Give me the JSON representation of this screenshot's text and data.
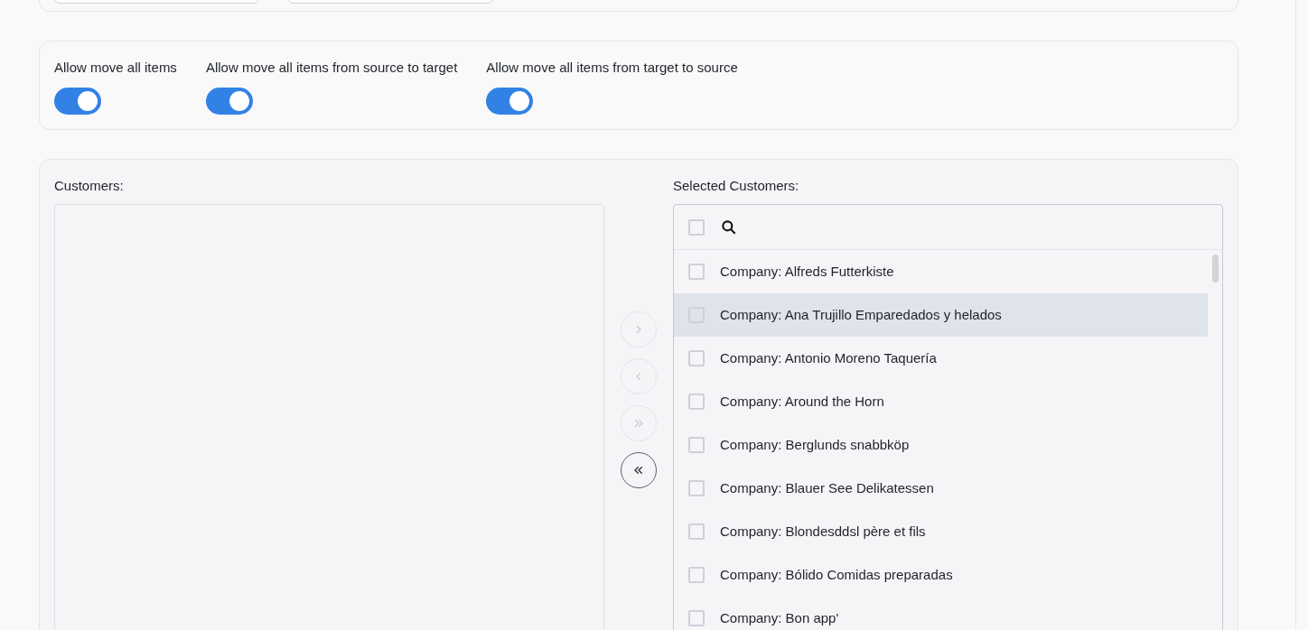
{
  "top_fields": [
    {
      "kind": "input"
    },
    {
      "kind": "input"
    }
  ],
  "switches": [
    {
      "label": "Allow move all items",
      "on": true
    },
    {
      "label": "Allow move all items from source to target",
      "on": true
    },
    {
      "label": "Allow move all items from target to source",
      "on": true
    }
  ],
  "source_list": {
    "label": "Customers:"
  },
  "transfer_buttons": [
    {
      "kind": "right",
      "disabled": true
    },
    {
      "kind": "left",
      "disabled": true
    },
    {
      "kind": "all-right",
      "disabled": true
    },
    {
      "kind": "all-left",
      "disabled": false
    }
  ],
  "target_list": {
    "label": "Selected Customers:",
    "select_all_checked": false,
    "items": [
      {
        "text": "Company: Alfreds Futterkiste",
        "checked": false,
        "highlighted": false
      },
      {
        "text": "Company: Ana Trujillo Emparedados y helados",
        "checked": false,
        "highlighted": true
      },
      {
        "text": "Company: Antonio Moreno Taquería",
        "checked": false,
        "highlighted": false
      },
      {
        "text": "Company: Around the Horn",
        "checked": false,
        "highlighted": false
      },
      {
        "text": "Company: Berglunds snabbköp",
        "checked": false,
        "highlighted": false
      },
      {
        "text": "Company: Blauer See Delikatessen",
        "checked": false,
        "highlighted": false
      },
      {
        "text": "Company: Blondesddsl père et fils",
        "checked": false,
        "highlighted": false
      },
      {
        "text": "Company: Bólido Comidas preparadas",
        "checked": false,
        "highlighted": false
      },
      {
        "text": "Company: Bon app'",
        "checked": false,
        "highlighted": false
      }
    ]
  }
}
